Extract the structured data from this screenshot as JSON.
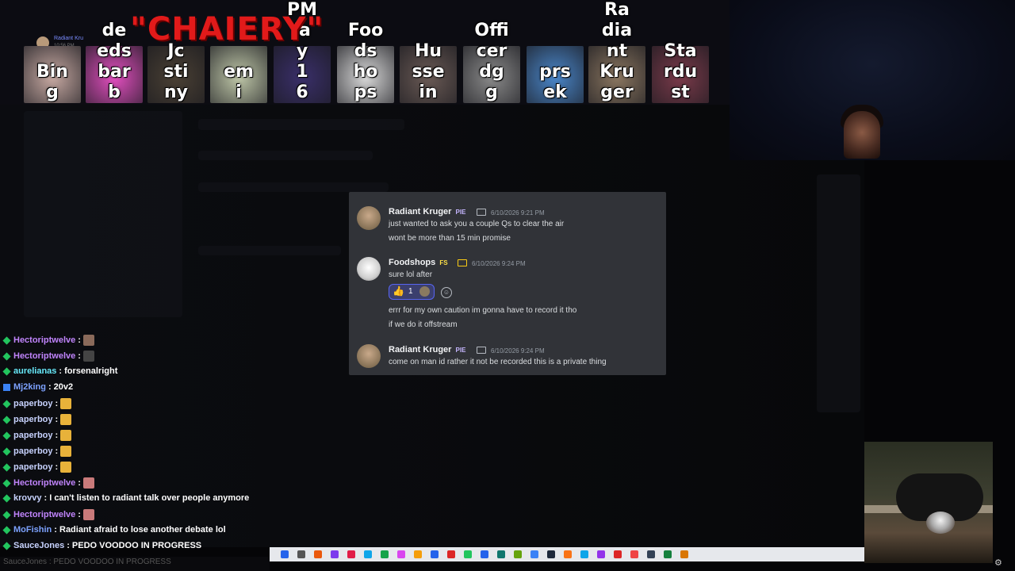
{
  "overlay": {
    "banner_text": "CHAIERY",
    "tiles": [
      {
        "label": "Bin\ng",
        "color": "#c7a9a2"
      },
      {
        "label": "de\neds\nbar\nb",
        "color": "#e24fbf"
      },
      {
        "label": "Jc\nsti\nny",
        "color": "#4a4034"
      },
      {
        "label": "em\ni",
        "color": "#bfc7a8"
      },
      {
        "label": "PM\n'a\ny\n1\n6",
        "color": "#3a2f6a"
      },
      {
        "label": "Foo\nds\nho\nps",
        "color": "#d8d8d8"
      },
      {
        "label": "Hu\nsse\nin",
        "color": "#6a5a55"
      },
      {
        "label": "Offi\ncer\ndg\ng",
        "color": "#8a8a8a"
      },
      {
        "label": "prs\nek",
        "color": "#4a86c9"
      },
      {
        "label": "Ra\ndia\nnt\nKru\nger",
        "color": "#8a7660"
      },
      {
        "label": "Sta\nrdu\nst",
        "color": "#7a3a4a"
      }
    ],
    "mini_user": {
      "name": "Radiant Kru",
      "time": "10:56 PM"
    }
  },
  "dialog": {
    "messages": [
      {
        "author": "Radiant Kruger",
        "badge": "PIE",
        "badge_color": "#a78bfa",
        "timestamp": "6/10/2026 9:21 PM",
        "lines": [
          "just wanted to ask you a couple Qs to clear the air",
          "wont be more than 15 min promise"
        ]
      },
      {
        "author": "Foodshops",
        "badge": "FS",
        "badge_color": "#facc15",
        "timestamp": "6/10/2026 9:24 PM",
        "lines": [
          "sure lol after"
        ],
        "reaction": {
          "emoji": "👍",
          "count": "1"
        },
        "lines_after": [
          "errr for my own caution im gonna have to record it tho",
          "if we do it offstream"
        ]
      },
      {
        "author": "Radiant Kruger",
        "badge": "PIE",
        "badge_color": "#a78bfa",
        "timestamp": "6/10/2026 9:24 PM",
        "lines": [
          "come on man id rather it not be recorded this is a private thing"
        ]
      }
    ]
  },
  "chat": [
    {
      "user": "Hectoriptwelve",
      "color": "#c084fc",
      "text": ":"
    },
    {
      "user": "Hectoriptwelve",
      "color": "#c084fc",
      "text": ":"
    },
    {
      "user": "aurelianas",
      "color": "#67e8f9",
      "text": ": forsenalright"
    },
    {
      "user": "Mj2king",
      "color": "#7da2ff",
      "text": ": 20v2"
    },
    {
      "user": "paperboy",
      "color": "#c7d2fe",
      "text": ":"
    },
    {
      "user": "paperboy",
      "color": "#c7d2fe",
      "text": ":"
    },
    {
      "user": "paperboy",
      "color": "#c7d2fe",
      "text": ":"
    },
    {
      "user": "paperboy",
      "color": "#c7d2fe",
      "text": ":"
    },
    {
      "user": "paperboy",
      "color": "#c7d2fe",
      "text": ":"
    },
    {
      "user": "Hectoriptwelve",
      "color": "#c084fc",
      "text": ":"
    },
    {
      "user": "krovvy",
      "color": "#c7d2fe",
      "text": ": I can't listen to radiant talk over people anymore"
    },
    {
      "user": "Hectoriptwelve",
      "color": "#c084fc",
      "text": ":"
    },
    {
      "user": "MoFishin",
      "color": "#7da2ff",
      "text": ": Radiant afraid to lose another debate lol"
    },
    {
      "user": "SauceJones",
      "color": "#c7d2fe",
      "text": ": PEDO VOODOO IN PROGRESS"
    }
  ],
  "chat_last_line_echo": "SauceJones : PEDO VOODOO IN PROGRESS"
}
